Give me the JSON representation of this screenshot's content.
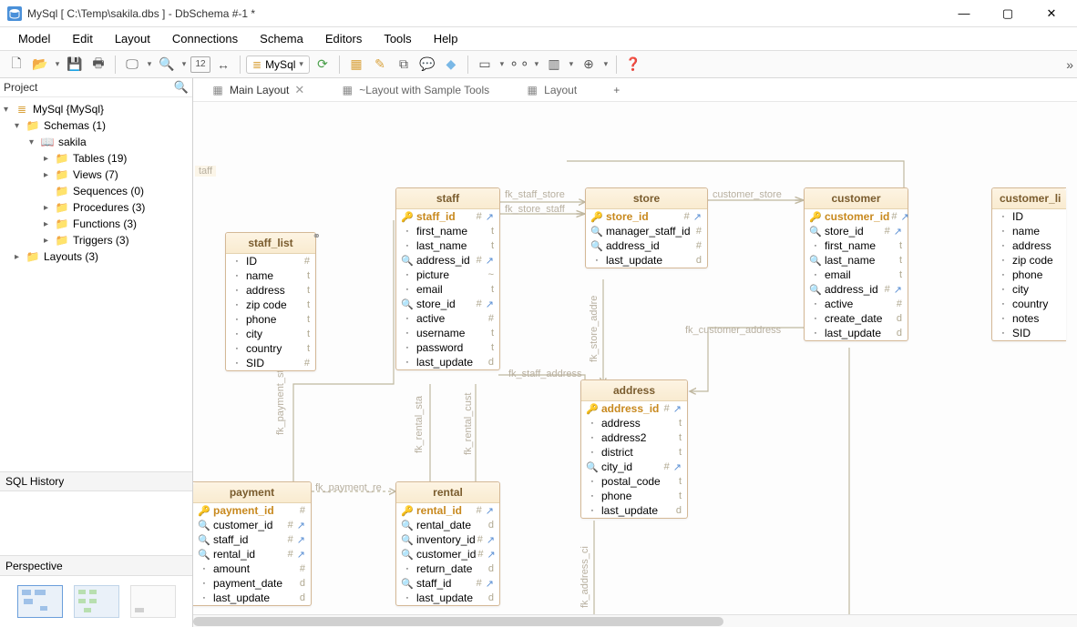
{
  "window": {
    "title": "MySql [ C:\\Temp\\sakila.dbs ] - DbSchema #-1 *",
    "min": "—",
    "max": "▢",
    "close": "✕"
  },
  "menu": [
    "Model",
    "Edit",
    "Layout",
    "Connections",
    "Schema",
    "Editors",
    "Tools",
    "Help"
  ],
  "toolbar": {
    "db_selector": "MySql",
    "overflow": "»"
  },
  "project_panel": "Project",
  "search_placeholder": "",
  "tree": {
    "db": "MySql {MySql}",
    "schemas": "Schemas (1)",
    "schema": "sakila",
    "tables": "Tables (19)",
    "views": "Views (7)",
    "sequences": "Sequences (0)",
    "procedures": "Procedures (3)",
    "functions": "Functions (3)",
    "triggers": "Triggers (3)",
    "layouts": "Layouts (3)"
  },
  "sql_history": "SQL History",
  "perspective": "Perspective",
  "tabs": {
    "main": "Main Layout",
    "sample": "~Layout with Sample Tools",
    "layout": "Layout",
    "add": "+"
  },
  "floating_label": "taff",
  "rel_labels": {
    "fk_staff_store": "fk_staff_store",
    "fk_store_staff": "fk_store_staff",
    "customer_store": "customer_store",
    "fk_customer_address": "fk_customer_address",
    "fk_staff_address": "fk_staff_address",
    "fk_payment_re": "fk_payment_re",
    "fk_payment_st": "fk_payment_st",
    "fk_rental_sta": "fk_rental_sta",
    "fk_rental_cust": "fk_rental_cust",
    "fk_store_addre": "fk_store_addre",
    "fk_address_ci": "fk_address_ci"
  },
  "entities": {
    "staff_list": {
      "title": "staff_list",
      "cols": [
        {
          "n": "ID",
          "t": "#"
        },
        {
          "n": "name",
          "t": "t"
        },
        {
          "n": "address",
          "t": "t"
        },
        {
          "n": "zip code",
          "t": "t"
        },
        {
          "n": "phone",
          "t": "t"
        },
        {
          "n": "city",
          "t": "t"
        },
        {
          "n": "country",
          "t": "t"
        },
        {
          "n": "SID",
          "t": "#"
        }
      ]
    },
    "staff": {
      "title": "staff",
      "cols": [
        {
          "i": "pk",
          "n": "staff_id",
          "t": "#",
          "r": "fk"
        },
        {
          "i": "",
          "n": "first_name",
          "t": "t"
        },
        {
          "i": "",
          "n": "last_name",
          "t": "t"
        },
        {
          "i": "idx",
          "n": "address_id",
          "t": "#",
          "r": "fk"
        },
        {
          "i": "",
          "n": "picture",
          "t": "~"
        },
        {
          "i": "",
          "n": "email",
          "t": "t"
        },
        {
          "i": "idx",
          "n": "store_id",
          "t": "#",
          "r": "fk"
        },
        {
          "i": "",
          "n": "active",
          "t": "#"
        },
        {
          "i": "",
          "n": "username",
          "t": "t"
        },
        {
          "i": "",
          "n": "password",
          "t": "t"
        },
        {
          "i": "",
          "n": "last_update",
          "t": "d"
        }
      ]
    },
    "store": {
      "title": "store",
      "cols": [
        {
          "i": "pk",
          "n": "store_id",
          "t": "#",
          "r": "fk"
        },
        {
          "i": "idx",
          "n": "manager_staff_id",
          "t": "#"
        },
        {
          "i": "idx",
          "n": "address_id",
          "t": "#"
        },
        {
          "i": "",
          "n": "last_update",
          "t": "d"
        }
      ]
    },
    "customer": {
      "title": "customer",
      "cols": [
        {
          "i": "pk",
          "n": "customer_id",
          "t": "#",
          "r": "fk"
        },
        {
          "i": "idx",
          "n": "store_id",
          "t": "#",
          "r": "fk"
        },
        {
          "i": "",
          "n": "first_name",
          "t": "t"
        },
        {
          "i": "idx",
          "n": "last_name",
          "t": "t"
        },
        {
          "i": "",
          "n": "email",
          "t": "t"
        },
        {
          "i": "idx",
          "n": "address_id",
          "t": "#",
          "r": "fk"
        },
        {
          "i": "",
          "n": "active",
          "t": "#"
        },
        {
          "i": "",
          "n": "create_date",
          "t": "d"
        },
        {
          "i": "",
          "n": "last_update",
          "t": "d"
        }
      ]
    },
    "customer_li": {
      "title": "customer_li",
      "cols": [
        {
          "n": "ID"
        },
        {
          "n": "name"
        },
        {
          "n": "address"
        },
        {
          "n": "zip code"
        },
        {
          "n": "phone"
        },
        {
          "n": "city"
        },
        {
          "n": "country"
        },
        {
          "n": "notes"
        },
        {
          "n": "SID"
        }
      ]
    },
    "address": {
      "title": "address",
      "cols": [
        {
          "i": "pk",
          "n": "address_id",
          "t": "#",
          "r": "fk"
        },
        {
          "i": "",
          "n": "address",
          "t": "t"
        },
        {
          "i": "",
          "n": "address2",
          "t": "t"
        },
        {
          "i": "",
          "n": "district",
          "t": "t"
        },
        {
          "i": "idx",
          "n": "city_id",
          "t": "#",
          "r": "fk"
        },
        {
          "i": "",
          "n": "postal_code",
          "t": "t"
        },
        {
          "i": "",
          "n": "phone",
          "t": "t"
        },
        {
          "i": "",
          "n": "last_update",
          "t": "d"
        }
      ]
    },
    "payment": {
      "title": "payment",
      "cols": [
        {
          "i": "pk",
          "n": "payment_id",
          "t": "#"
        },
        {
          "i": "idx",
          "n": "customer_id",
          "t": "#",
          "r": "fk"
        },
        {
          "i": "idx",
          "n": "staff_id",
          "t": "#",
          "r": "fk"
        },
        {
          "i": "idx",
          "n": "rental_id",
          "t": "#",
          "r": "fk"
        },
        {
          "i": "",
          "n": "amount",
          "t": "#"
        },
        {
          "i": "",
          "n": "payment_date",
          "t": "d"
        },
        {
          "i": "",
          "n": "last_update",
          "t": "d"
        }
      ]
    },
    "rental": {
      "title": "rental",
      "cols": [
        {
          "i": "pk",
          "n": "rental_id",
          "t": "#",
          "r": "fk"
        },
        {
          "i": "idx",
          "n": "rental_date",
          "t": "d"
        },
        {
          "i": "idx",
          "n": "inventory_id",
          "t": "#",
          "r": "fk"
        },
        {
          "i": "idx",
          "n": "customer_id",
          "t": "#",
          "r": "fk"
        },
        {
          "i": "",
          "n": "return_date",
          "t": "d"
        },
        {
          "i": "idx",
          "n": "staff_id",
          "t": "#",
          "r": "fk"
        },
        {
          "i": "",
          "n": "last_update",
          "t": "d"
        }
      ]
    }
  }
}
